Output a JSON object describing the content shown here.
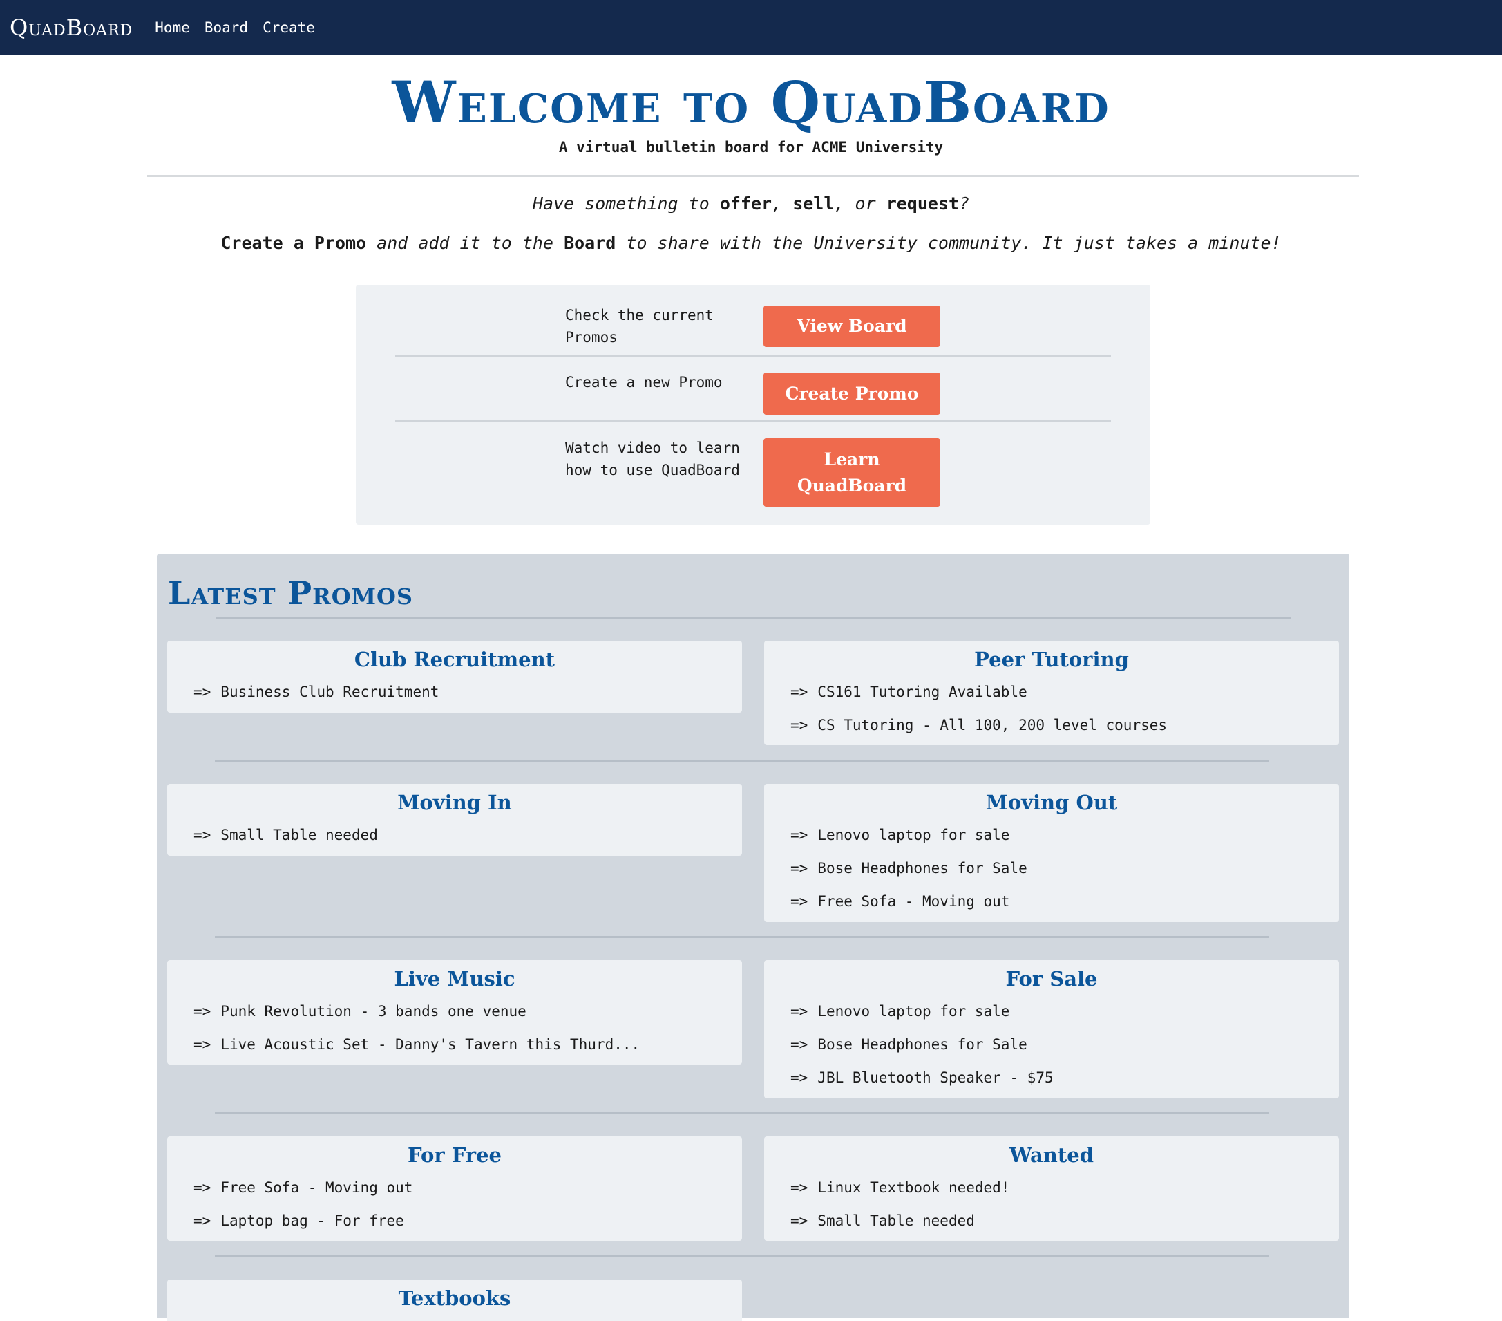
{
  "nav": {
    "brand": "QuadBoard",
    "links": [
      "Home",
      "Board",
      "Create"
    ]
  },
  "hero": {
    "title": "Welcome to QuadBoard",
    "subtitle": "A virtual bulletin board for ACME University",
    "tagline_prefix": "Have something to ",
    "tagline_offer": "offer",
    "tagline_sep1": ", ",
    "tagline_sell": "sell",
    "tagline_sep2": ", or ",
    "tagline_request": "request",
    "tagline_suffix": "?",
    "pitch_create": "Create a Promo",
    "pitch_mid": " and add it to the ",
    "pitch_board": "Board",
    "pitch_end": " to share with the University community. It just takes a minute!"
  },
  "actions": [
    {
      "text": "Check the current Promos",
      "button": "View Board"
    },
    {
      "text": "Create a new Promo",
      "button": "Create Promo"
    },
    {
      "text": "Watch video to learn how to use QuadBoard",
      "button": "Learn QuadBoard"
    }
  ],
  "promos": {
    "title": "Latest Promos",
    "arrow": "=>",
    "cards": [
      {
        "title": "Club Recruitment",
        "items": [
          "Business Club Recruitment"
        ]
      },
      {
        "title": "Peer Tutoring",
        "items": [
          "CS161 Tutoring Available",
          "CS Tutoring - All 100, 200 level courses"
        ]
      },
      {
        "title": "Moving In",
        "items": [
          "Small Table needed"
        ]
      },
      {
        "title": "Moving Out",
        "items": [
          "Lenovo laptop for sale",
          "Bose Headphones for Sale",
          "Free Sofa - Moving out"
        ]
      },
      {
        "title": "Live Music",
        "items": [
          "Punk Revolution - 3 bands one venue",
          "Live Acoustic Set - Danny's Tavern this Thurd..."
        ]
      },
      {
        "title": "For Sale",
        "items": [
          "Lenovo laptop for sale",
          "Bose Headphones for Sale",
          "JBL Bluetooth Speaker - $75"
        ]
      },
      {
        "title": "For Free",
        "items": [
          "Free Sofa - Moving out",
          "Laptop bag - For free"
        ]
      },
      {
        "title": "Wanted",
        "items": [
          "Linux Textbook needed!",
          "Small Table needed"
        ]
      },
      {
        "title": "Textbooks",
        "items": []
      }
    ]
  }
}
